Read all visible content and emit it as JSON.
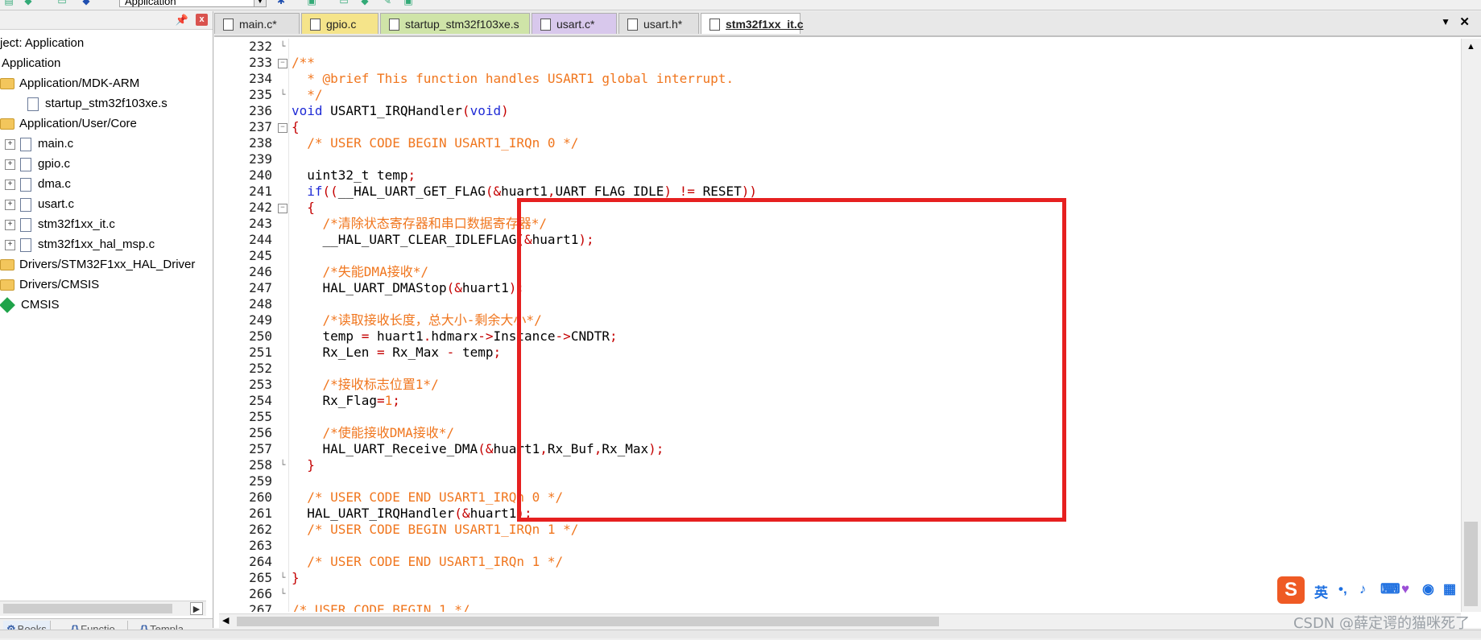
{
  "toolbar": {
    "target_combo": "Application"
  },
  "project_panel": {
    "root_label": "ject: Application",
    "items": [
      {
        "label": "Application",
        "kind": "target",
        "indent": 0
      },
      {
        "label": "Application/MDK-ARM",
        "kind": "folder",
        "indent": 0
      },
      {
        "label": "startup_stm32f103xe.s",
        "kind": "file",
        "indent": 2
      },
      {
        "label": "Application/User/Core",
        "kind": "folder",
        "indent": 0
      },
      {
        "label": "main.c",
        "kind": "file",
        "indent": 1
      },
      {
        "label": "gpio.c",
        "kind": "file",
        "indent": 1
      },
      {
        "label": "dma.c",
        "kind": "file",
        "indent": 1
      },
      {
        "label": "usart.c",
        "kind": "file",
        "indent": 1
      },
      {
        "label": "stm32f1xx_it.c",
        "kind": "file",
        "indent": 1
      },
      {
        "label": "stm32f1xx_hal_msp.c",
        "kind": "file",
        "indent": 1
      },
      {
        "label": "Drivers/STM32F1xx_HAL_Driver",
        "kind": "folder",
        "indent": 0
      },
      {
        "label": "Drivers/CMSIS",
        "kind": "folder",
        "indent": 0
      },
      {
        "label": "CMSIS",
        "kind": "gem",
        "indent": 0
      }
    ],
    "bottom_tabs": [
      "Books",
      "Functio...",
      "Templa..."
    ]
  },
  "file_tabs": [
    {
      "label": "main.c*",
      "color": "#e0e0e0",
      "active": false
    },
    {
      "label": "gpio.c",
      "color": "#f5e48a",
      "active": false
    },
    {
      "label": "startup_stm32f103xe.s",
      "color": "#cfe4a8",
      "active": false
    },
    {
      "label": "usart.c*",
      "color": "#d8c8ec",
      "active": false
    },
    {
      "label": "usart.h*",
      "color": "#e0e0e0",
      "active": false
    },
    {
      "label": "stm32f1xx_it.c",
      "color": "#ffffff",
      "active": true
    }
  ],
  "code_lines": [
    {
      "n": "232",
      "fold": "end",
      "segs": []
    },
    {
      "n": "233",
      "fold": "box",
      "segs": [
        [
          "cm",
          "/**"
        ]
      ]
    },
    {
      "n": "234",
      "fold": "",
      "segs": [
        [
          "cm",
          "  * @brief This function handles USART1 global interrupt."
        ]
      ]
    },
    {
      "n": "235",
      "fold": "end",
      "segs": [
        [
          "cm",
          "  */"
        ]
      ]
    },
    {
      "n": "236",
      "fold": "",
      "segs": [
        [
          "kw",
          "void"
        ],
        [
          "",
          " USART1_IRQHandler"
        ],
        [
          "op",
          "("
        ],
        [
          "kw",
          "void"
        ],
        [
          "op",
          ")"
        ]
      ]
    },
    {
      "n": "237",
      "fold": "box",
      "segs": [
        [
          "op",
          "{"
        ]
      ]
    },
    {
      "n": "238",
      "fold": "",
      "segs": [
        [
          "",
          "  "
        ],
        [
          "cm",
          "/* USER CODE BEGIN USART1_IRQn 0 */"
        ]
      ]
    },
    {
      "n": "239",
      "fold": "",
      "segs": []
    },
    {
      "n": "240",
      "fold": "",
      "segs": [
        [
          "",
          "  uint32_t temp"
        ],
        [
          "op",
          ";"
        ]
      ]
    },
    {
      "n": "241",
      "fold": "",
      "segs": [
        [
          "",
          "  "
        ],
        [
          "kw",
          "if"
        ],
        [
          "op",
          "(("
        ],
        [
          "",
          "__HAL_UART_GET_FLAG"
        ],
        [
          "op",
          "(&"
        ],
        [
          "",
          "huart1"
        ],
        [
          "op",
          ","
        ],
        [
          "",
          "UART_FLAG_IDLE"
        ],
        [
          "op",
          ") != "
        ],
        [
          "",
          "RESET"
        ],
        [
          "op",
          "))"
        ]
      ]
    },
    {
      "n": "242",
      "fold": "box",
      "segs": [
        [
          "",
          "  "
        ],
        [
          "op",
          "{"
        ]
      ]
    },
    {
      "n": "243",
      "fold": "",
      "segs": [
        [
          "",
          "    "
        ],
        [
          "cm",
          "/*清除状态寄存器和串口数据寄存器*/"
        ]
      ]
    },
    {
      "n": "244",
      "fold": "",
      "segs": [
        [
          "",
          "    __HAL_UART_CLEAR_IDLEFLAG"
        ],
        [
          "op",
          "(&"
        ],
        [
          "",
          "huart1"
        ],
        [
          "op",
          ");"
        ]
      ]
    },
    {
      "n": "245",
      "fold": "",
      "segs": []
    },
    {
      "n": "246",
      "fold": "",
      "segs": [
        [
          "",
          "    "
        ],
        [
          "cm",
          "/*失能DMA接收*/"
        ]
      ]
    },
    {
      "n": "247",
      "fold": "",
      "segs": [
        [
          "",
          "    HAL_UART_DMAStop"
        ],
        [
          "op",
          "(&"
        ],
        [
          "",
          "huart1"
        ],
        [
          "op",
          ");"
        ]
      ]
    },
    {
      "n": "248",
      "fold": "",
      "segs": []
    },
    {
      "n": "249",
      "fold": "",
      "segs": [
        [
          "",
          "    "
        ],
        [
          "cm",
          "/*读取接收长度，总大小-剩余大小*/"
        ]
      ]
    },
    {
      "n": "250",
      "fold": "",
      "segs": [
        [
          "",
          "    temp "
        ],
        [
          "op",
          "="
        ],
        [
          "",
          " huart1"
        ],
        [
          "op",
          "."
        ],
        [
          "",
          "hdmarx"
        ],
        [
          "op",
          "->"
        ],
        [
          "",
          "Instance"
        ],
        [
          "op",
          "->"
        ],
        [
          "",
          "CNDTR"
        ],
        [
          "op",
          ";"
        ]
      ]
    },
    {
      "n": "251",
      "fold": "",
      "segs": [
        [
          "",
          "    Rx_Len "
        ],
        [
          "op",
          "="
        ],
        [
          "",
          " Rx_Max "
        ],
        [
          "op",
          "-"
        ],
        [
          "",
          " temp"
        ],
        [
          "op",
          ";"
        ]
      ]
    },
    {
      "n": "252",
      "fold": "",
      "segs": []
    },
    {
      "n": "253",
      "fold": "",
      "segs": [
        [
          "",
          "    "
        ],
        [
          "cm",
          "/*接收标志位置1*/"
        ]
      ]
    },
    {
      "n": "254",
      "fold": "",
      "segs": [
        [
          "",
          "    Rx_Flag"
        ],
        [
          "op",
          "="
        ],
        [
          "cm",
          "1"
        ],
        [
          "op",
          ";"
        ]
      ]
    },
    {
      "n": "255",
      "fold": "",
      "segs": []
    },
    {
      "n": "256",
      "fold": "",
      "segs": [
        [
          "",
          "    "
        ],
        [
          "cm",
          "/*使能接收DMA接收*/"
        ]
      ]
    },
    {
      "n": "257",
      "fold": "",
      "segs": [
        [
          "",
          "    HAL_UART_Receive_DMA"
        ],
        [
          "op",
          "(&"
        ],
        [
          "",
          "huart1"
        ],
        [
          "op",
          ","
        ],
        [
          "",
          "Rx_Buf"
        ],
        [
          "op",
          ","
        ],
        [
          "",
          "Rx_Max"
        ],
        [
          "op",
          ");"
        ]
      ]
    },
    {
      "n": "258",
      "fold": "end",
      "segs": [
        [
          "",
          "  "
        ],
        [
          "op",
          "}"
        ]
      ]
    },
    {
      "n": "259",
      "fold": "",
      "segs": []
    },
    {
      "n": "260",
      "fold": "",
      "segs": [
        [
          "",
          "  "
        ],
        [
          "cm",
          "/* USER CODE END USART1_IRQn 0 */"
        ]
      ]
    },
    {
      "n": "261",
      "fold": "",
      "segs": [
        [
          "",
          "  HAL_UART_IRQHandler"
        ],
        [
          "op",
          "(&"
        ],
        [
          "",
          "huart1"
        ],
        [
          "op",
          ");"
        ]
      ]
    },
    {
      "n": "262",
      "fold": "",
      "segs": [
        [
          "",
          "  "
        ],
        [
          "cm",
          "/* USER CODE BEGIN USART1_IRQn 1 */"
        ]
      ]
    },
    {
      "n": "263",
      "fold": "",
      "segs": []
    },
    {
      "n": "264",
      "fold": "",
      "segs": [
        [
          "",
          "  "
        ],
        [
          "cm",
          "/* USER CODE END USART1_IRQn 1 */"
        ]
      ]
    },
    {
      "n": "265",
      "fold": "end",
      "segs": [
        [
          "op",
          "}"
        ]
      ]
    },
    {
      "n": "266",
      "fold": "end",
      "segs": []
    },
    {
      "n": "267",
      "fold": "",
      "segs": [
        [
          "cm",
          "/* USER CODE BEGIN 1 */"
        ]
      ]
    }
  ],
  "ime": {
    "lang": "英"
  },
  "watermark": "CSDN @薛定谔的猫咪死了"
}
